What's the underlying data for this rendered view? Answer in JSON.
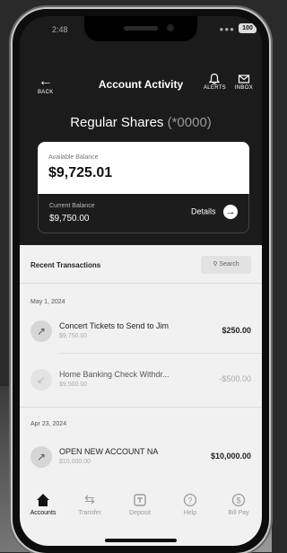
{
  "status_bar": {
    "time": "2:48",
    "signal": "●●●",
    "battery": "100"
  },
  "header": {
    "back_label": "BACK",
    "title": "Account Activity",
    "alerts_label": "ALERTS",
    "inbox_label": "INBOX"
  },
  "account": {
    "name": "Regular Shares",
    "masked_number": "(*0000)"
  },
  "available": {
    "label": "Available Balance",
    "amount": "$9,725.01"
  },
  "current": {
    "label": "Current Balance",
    "amount": "$9,750.00",
    "details_label": "Details"
  },
  "transactions": {
    "heading": "Recent Transactions",
    "search_label": "Search",
    "groups": [
      {
        "date": "May 1, 2024",
        "items": [
          {
            "name": "Concert Tickets to Send to Jim",
            "balance": "$9,750.00",
            "amount": "$250.00",
            "pending": false
          },
          {
            "name": "Home Banking Check Withdr...",
            "balance": "$9,500.00",
            "amount": "-$500.00",
            "pending": true
          }
        ]
      },
      {
        "date": "Apr 23, 2024",
        "items": [
          {
            "name": "OPEN NEW ACCOUNT NA",
            "balance": "$10,000.00",
            "amount": "$10,000.00",
            "pending": false
          }
        ]
      }
    ]
  },
  "tabbar": {
    "tabs": [
      {
        "label": "Accounts",
        "icon": "home-icon",
        "active": true
      },
      {
        "label": "Transfer",
        "icon": "transfer-icon",
        "active": false
      },
      {
        "label": "Deposit",
        "icon": "deposit-icon",
        "active": false
      },
      {
        "label": "Help",
        "icon": "help-icon",
        "active": false
      },
      {
        "label": "Bill Pay",
        "icon": "bill-pay-icon",
        "active": false
      }
    ]
  },
  "colors": {
    "dark": "#1b1b1b",
    "sheet": "#f1f1f1",
    "white_card": "#ffffff"
  }
}
